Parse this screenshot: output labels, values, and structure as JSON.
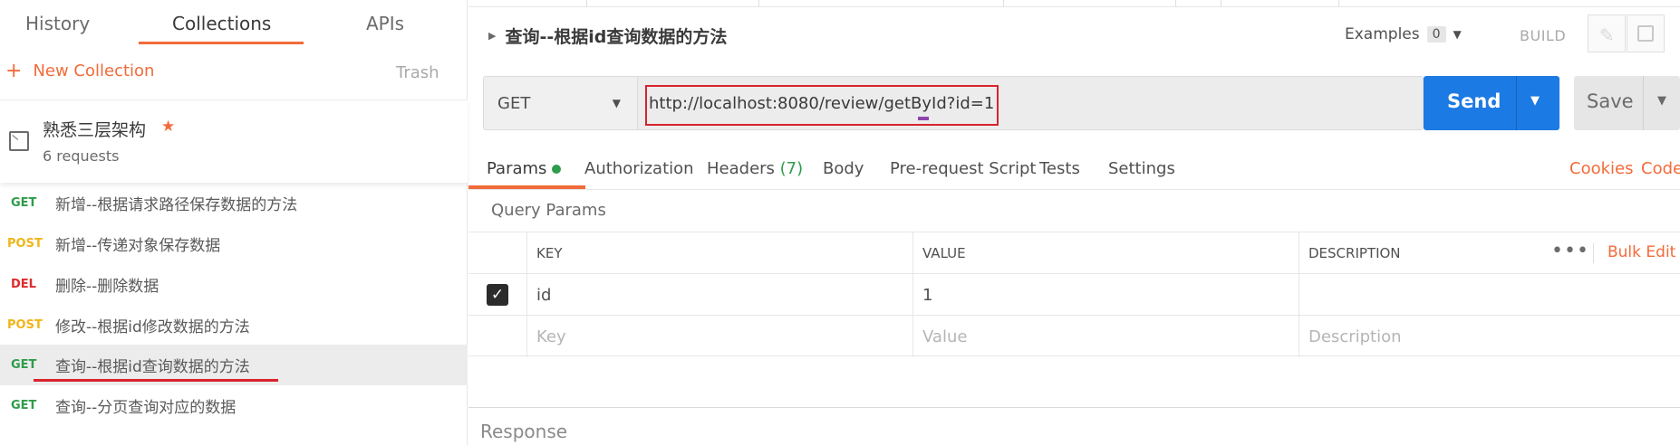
{
  "sidebar": {
    "tabs": [
      "History",
      "Collections",
      "APIs"
    ],
    "new_collection": "New Collection",
    "trash": "Trash",
    "collection": {
      "name": "熟悉三层架构",
      "count": "6 requests"
    },
    "requests": [
      {
        "method": "GET",
        "name": "新增--根据请求路径保存数据的方法"
      },
      {
        "method": "POST",
        "name": "新增--传递对象保存数据"
      },
      {
        "method": "DEL",
        "name": "删除--删除数据"
      },
      {
        "method": "POST",
        "name": "修改--根据id修改数据的方法"
      },
      {
        "method": "GET",
        "name": "查询--根据id查询数据的方法"
      },
      {
        "method": "GET",
        "name": "查询--分页查询对应的数据"
      }
    ]
  },
  "request": {
    "title": "查询--根据id查询数据的方法",
    "examples_label": "Examples",
    "examples_count": "0",
    "build": "BUILD",
    "method": "GET",
    "url": "http://localhost:8080/review/getById?id=1",
    "send": "Send",
    "save": "Save"
  },
  "subtabs": {
    "params": "Params",
    "authorization": "Authorization",
    "headers": "Headers",
    "headers_count": "(7)",
    "body": "Body",
    "prerequest": "Pre-request Script",
    "tests": "Tests",
    "settings": "Settings",
    "cookies": "Cookies",
    "code": "Code"
  },
  "params": {
    "section_title": "Query Params",
    "columns": {
      "key": "KEY",
      "value": "VALUE",
      "description": "DESCRIPTION"
    },
    "bulk_edit": "Bulk Edit",
    "more": "•••",
    "row": {
      "key": "id",
      "value": "1"
    },
    "placeholders": {
      "key": "Key",
      "value": "Value",
      "description": "Description"
    }
  },
  "response": {
    "label": "Response"
  },
  "colors": {
    "accent": "#f26b3a",
    "send": "#1c7ae4",
    "get": "#2e9c4a",
    "post": "#f1b51a",
    "del": "#e02b2b",
    "highlight": "#d9232d"
  },
  "icons": [
    "plus-icon",
    "folder-icon",
    "star-icon",
    "caret-down-icon",
    "pencil-icon",
    "comment-icon",
    "checkbox-icon",
    "more-icon"
  ]
}
